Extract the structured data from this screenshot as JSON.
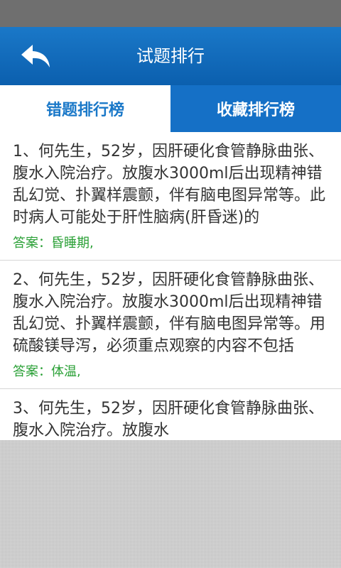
{
  "header": {
    "title": "试题排行",
    "back_icon": "back-arrow-icon"
  },
  "tabs": [
    {
      "label": "错题排行榜",
      "active": true
    },
    {
      "label": "收藏排行榜",
      "active": false
    }
  ],
  "items": [
    {
      "question": "1、何先生，52岁，因肝硬化食管静脉曲张、腹水入院治疗。放腹水3000ml后出现精神错乱幻觉、扑翼样震颤，伴有脑电图异常等。此时病人可能处于肝性脑病(肝昏迷)的",
      "answer": "答案：昏睡期,"
    },
    {
      "question": "2、何先生，52岁，因肝硬化食管静脉曲张、腹水入院治疗。放腹水3000ml后出现精神错乱幻觉、扑翼样震颤，伴有脑电图异常等。用硫酸镁导泻，必须重点观察的内容不包括",
      "answer": "答案：体温,"
    },
    {
      "question": "3、何先生，52岁，因肝硬化食管静脉曲张、腹水入院治疗。放腹水",
      "answer": ""
    }
  ],
  "colors": {
    "header": "#1a78c8",
    "answer": "#2aa036"
  }
}
